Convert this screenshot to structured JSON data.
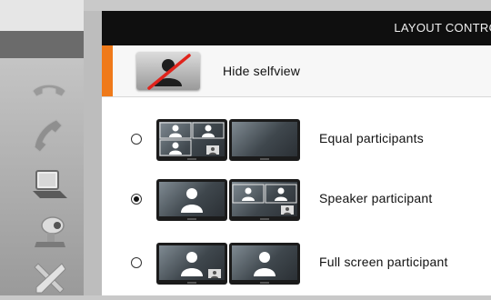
{
  "header": {
    "title": "LAYOUT CONTRO"
  },
  "selfview": {
    "label": "Hide selfview",
    "icon": "selfview-off-icon"
  },
  "layouts": [
    {
      "label": "Equal participants",
      "selected": false
    },
    {
      "label": "Speaker participant",
      "selected": true
    },
    {
      "label": "Full screen participant",
      "selected": false
    }
  ],
  "sidebar": {
    "icons": [
      "end-call-icon",
      "call-icon",
      "laptop-icon",
      "camera-icon",
      "tools-icon"
    ]
  },
  "colors": {
    "accent": "#ef7a1a",
    "titlebar": "#0f0f0f"
  }
}
